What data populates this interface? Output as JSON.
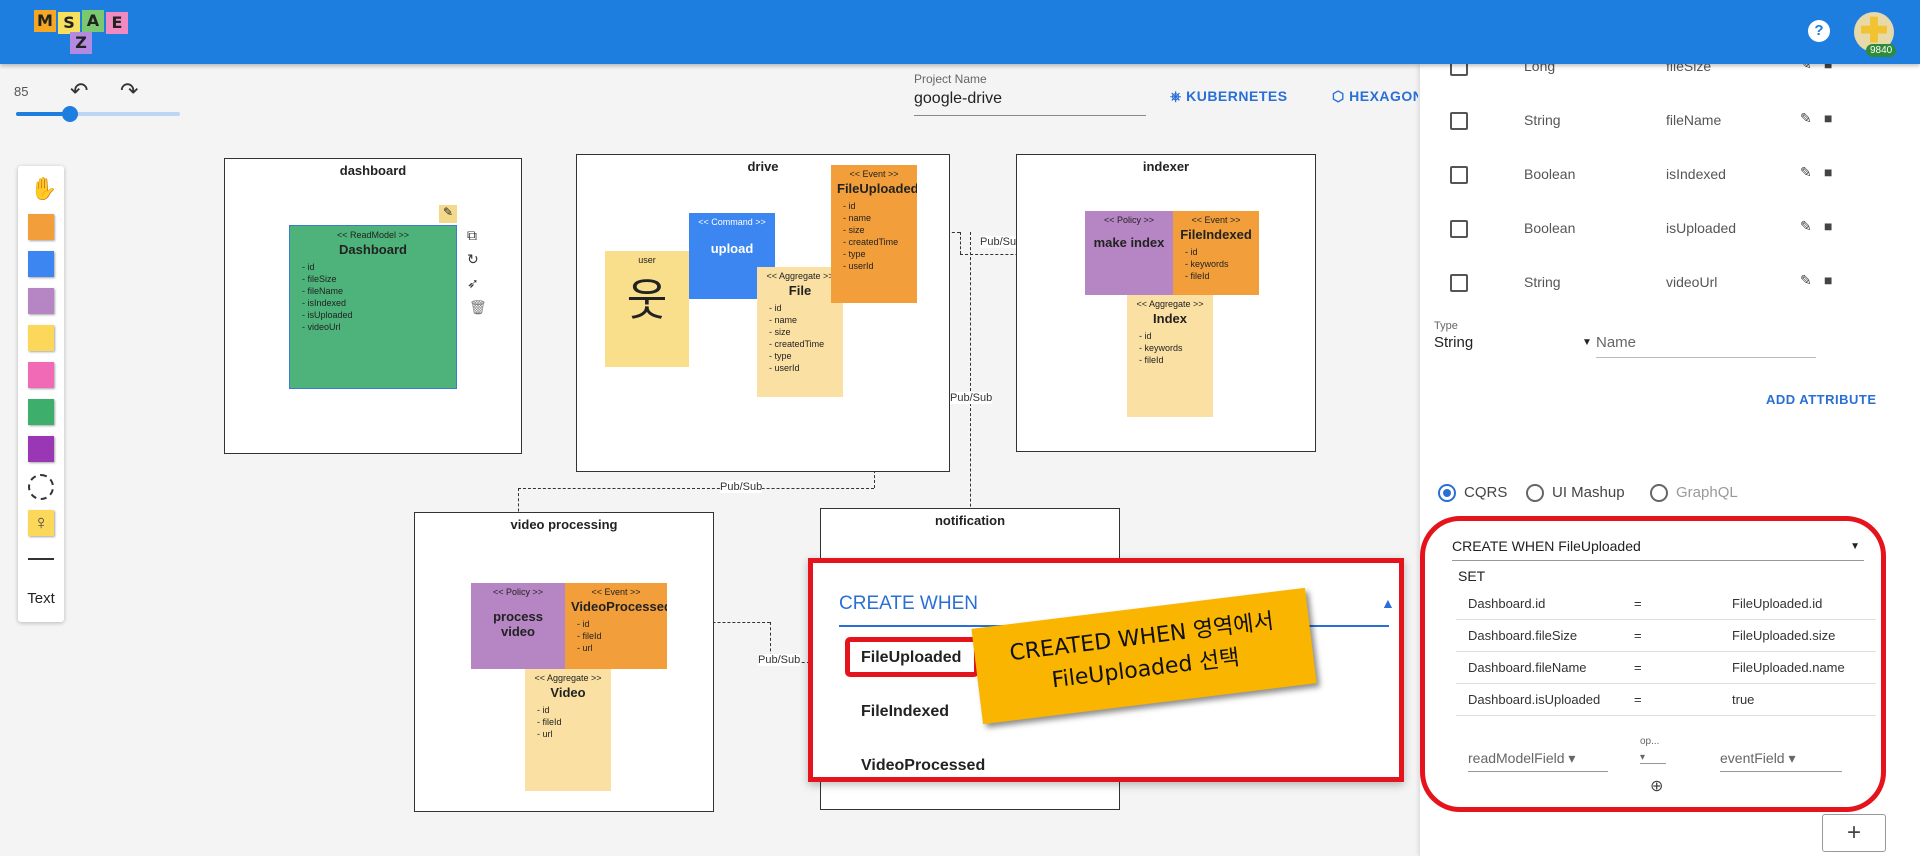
{
  "app": {
    "logo_letters": [
      "M",
      "S",
      "A",
      "E",
      "Z"
    ],
    "help_icon": "?",
    "credit": "9840"
  },
  "toolbar": {
    "zoom": "85",
    "zoom_fraction": 0.33,
    "undo_icon": "↶",
    "redo_icon": "↷"
  },
  "palette": {
    "hand_icon": "✋",
    "colors": [
      "#f29e3a",
      "#3b86f0",
      "#b685c3",
      "#fbd85a",
      "#f06ab5",
      "#3dae6c",
      "#9a37b5"
    ],
    "line_icon": "—",
    "text_label": "Text"
  },
  "project": {
    "label": "Project Name",
    "value": "google-drive"
  },
  "deploy": {
    "kubernetes": "KUBERNETES",
    "hexagonal": "HEXAGONAL"
  },
  "canvas": {
    "dashboard": {
      "title": "dashboard",
      "readmodel": {
        "stereotype": "<< ReadModel >>",
        "name": "Dashboard",
        "fields": [
          "id",
          "fileSize",
          "fileName",
          "isIndexed",
          "isUploaded",
          "videoUrl"
        ]
      }
    },
    "drive": {
      "title": "drive",
      "actor": "user",
      "command": {
        "stereotype": "<< Command >>",
        "name": "upload"
      },
      "aggregate": {
        "stereotype": "<< Aggregate >>",
        "name": "File",
        "fields": [
          "id",
          "name",
          "size",
          "createdTime",
          "type",
          "userId"
        ]
      },
      "event": {
        "stereotype": "<< Event >>",
        "name": "FileUploaded",
        "fields": [
          "id",
          "name",
          "size",
          "createdTime",
          "type",
          "userId"
        ]
      }
    },
    "indexer": {
      "title": "indexer",
      "policy": {
        "stereotype": "<< Policy >>",
        "name": "make index"
      },
      "event": {
        "stereotype": "<< Event >>",
        "name": "FileIndexed",
        "fields": [
          "id",
          "keywords",
          "fileId"
        ]
      },
      "aggregate": {
        "stereotype": "<< Aggregate >>",
        "name": "Index",
        "fields": [
          "id",
          "keywords",
          "fileId"
        ]
      }
    },
    "video": {
      "title": "video processing",
      "policy": {
        "stereotype": "<< Policy >>",
        "name": "process video"
      },
      "event": {
        "stereotype": "<< Event >>",
        "name": "VideoProcessed",
        "fields": [
          "id",
          "fileId",
          "url"
        ]
      },
      "aggregate": {
        "stereotype": "<< Aggregate >>",
        "name": "Video",
        "fields": [
          "id",
          "fileId",
          "url"
        ]
      }
    },
    "notification": {
      "title": "notification"
    },
    "edges": {
      "pubsub": "Pub/Sub"
    }
  },
  "panel": {
    "attributes": [
      {
        "type": "Long",
        "name": "fileSize"
      },
      {
        "type": "String",
        "name": "fileName"
      },
      {
        "type": "Boolean",
        "name": "isIndexed"
      },
      {
        "type": "Boolean",
        "name": "isUploaded"
      },
      {
        "type": "String",
        "name": "videoUrl"
      }
    ],
    "type_label": "Type",
    "type_value": "String",
    "name_placeholder": "Name",
    "add_attribute": "ADD ATTRIBUTE",
    "modes": [
      "CQRS",
      "UI Mashup",
      "GraphQL"
    ],
    "cqrs": {
      "create_when": "CREATE WHEN FileUploaded",
      "set_label": "SET",
      "mappings": [
        {
          "left": "Dashboard.id",
          "op": "=",
          "right": "FileUploaded.id"
        },
        {
          "left": "Dashboard.fileSize",
          "op": "=",
          "right": "FileUploaded.size"
        },
        {
          "left": "Dashboard.fileName",
          "op": "=",
          "right": "FileUploaded.name"
        },
        {
          "left": "Dashboard.isUploaded",
          "op": "=",
          "right": "true"
        }
      ],
      "new_left": "readModelField",
      "new_op": "op...",
      "new_right": "eventField"
    },
    "plus": "+"
  },
  "dropdown": {
    "label": "CREATE WHEN",
    "items": [
      "FileUploaded",
      "FileIndexed",
      "VideoProcessed"
    ]
  },
  "callout": {
    "line1": "CREATED WHEN 영역에서",
    "line2": "FileUploaded 선택"
  }
}
